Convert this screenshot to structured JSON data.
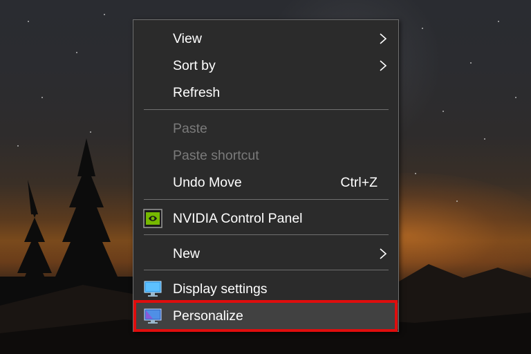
{
  "desktop": {
    "background": "night sky with trees and mountains at sunset"
  },
  "context_menu": {
    "items": [
      {
        "label": "View",
        "submenu": true,
        "enabled": true
      },
      {
        "label": "Sort by",
        "submenu": true,
        "enabled": true
      },
      {
        "label": "Refresh",
        "enabled": true
      },
      {
        "label": "Paste",
        "enabled": false
      },
      {
        "label": "Paste shortcut",
        "enabled": false
      },
      {
        "label": "Undo Move",
        "shortcut": "Ctrl+Z",
        "enabled": true
      },
      {
        "label": "NVIDIA Control Panel",
        "icon": "nvidia-icon",
        "enabled": true
      },
      {
        "label": "New",
        "submenu": true,
        "enabled": true
      },
      {
        "label": "Display settings",
        "icon": "monitor-icon",
        "enabled": true
      },
      {
        "label": "Personalize",
        "icon": "personalize-icon",
        "enabled": true,
        "highlighted": true
      }
    ]
  },
  "colors": {
    "menu_bg": "#2b2b2b",
    "menu_border": "#707070",
    "text": "#ffffff",
    "disabled_text": "#7a7a7a",
    "highlight_border": "#e00d0d",
    "nvidia_green": "#76b900",
    "monitor_blue": "#3aa0e8"
  }
}
